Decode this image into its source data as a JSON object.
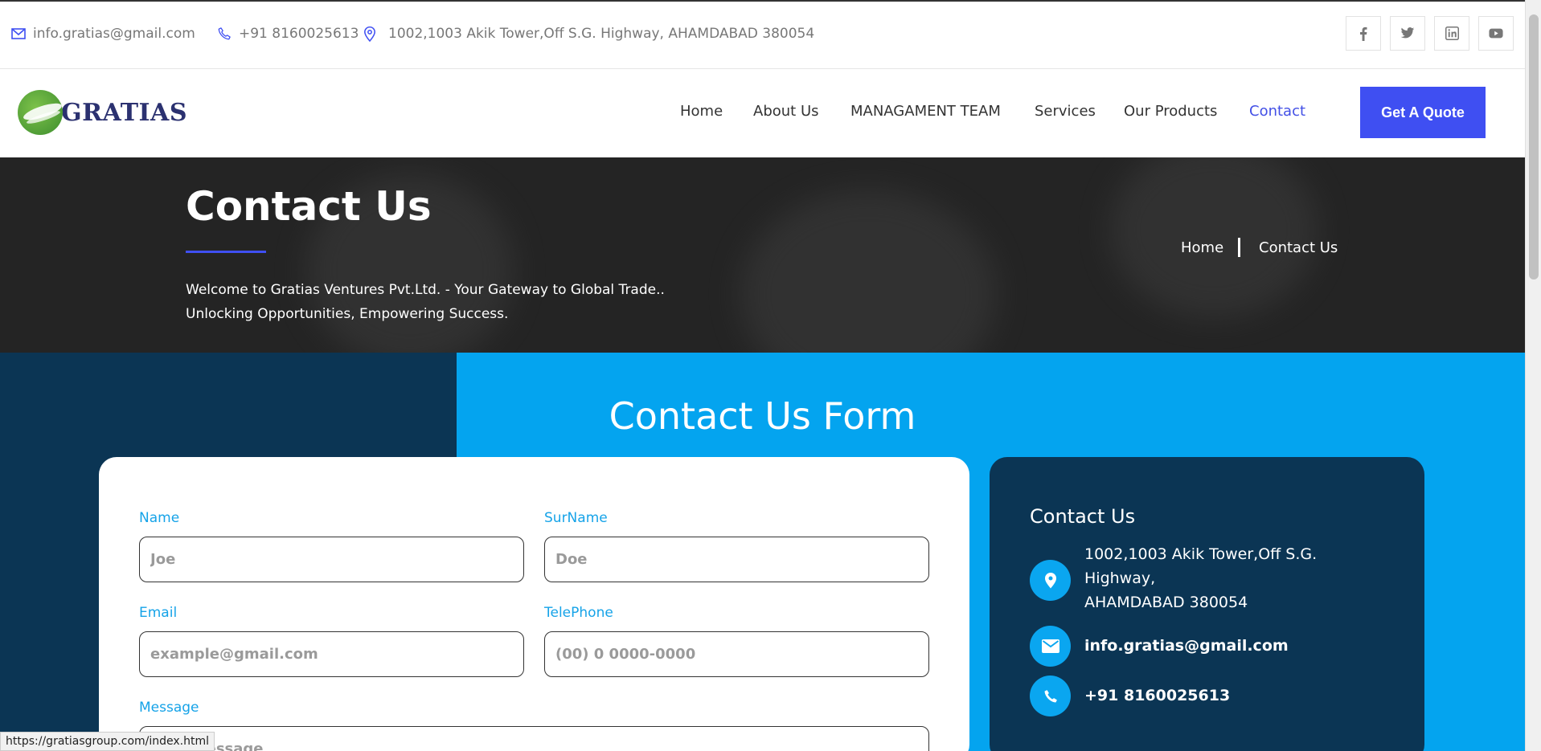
{
  "topbar": {
    "email": "info.gratias@gmail.com",
    "phone": "+91 8160025613",
    "address": "1002,1003 Akik Tower,Off S.G. Highway, AHAMDABAD 380054",
    "social": [
      "facebook-icon",
      "twitter-icon",
      "linkedin-icon",
      "youtube-icon"
    ]
  },
  "nav": {
    "logo_text": "GRATIAS",
    "items": [
      "Home",
      "About Us",
      "MANAGAMENT TEAM",
      "Services",
      "Our Products",
      "Contact"
    ],
    "active_item": "Contact",
    "quote_button": "Get A Quote"
  },
  "hero": {
    "title": "Contact Us",
    "welcome_line1": "Welcome to Gratias Ventures Pvt.Ltd. - Your Gateway to Global Trade..",
    "welcome_line2": "Unlocking Opportunities, Empowering Success.",
    "breadcrumb_home": "Home",
    "breadcrumb_current": "Contact Us"
  },
  "form": {
    "heading": "Contact Us Form",
    "name_label": "Name",
    "name_placeholder": "Joe",
    "surname_label": "SurName",
    "surname_placeholder": "Doe",
    "email_label": "Email",
    "email_placeholder": "example@gmail.com",
    "phone_label": "TelePhone",
    "phone_placeholder": "(00) 0 0000-0000",
    "message_label": "Message",
    "message_placeholder": "Your Message"
  },
  "contact_card": {
    "title": "Contact Us",
    "address_line1": "1002,1003 Akik Tower,Off S.G.",
    "address_line2": "Highway,",
    "address_line3": "AHAMDABAD 380054",
    "email": "info.gratias@gmail.com",
    "phone": "+91 8160025613"
  },
  "statusbar": {
    "url": "https://gratiasgroup.com/index.html"
  },
  "colors": {
    "accent": "#3f4ff2",
    "sky": "#04a4ef",
    "navy": "#0b3554"
  }
}
